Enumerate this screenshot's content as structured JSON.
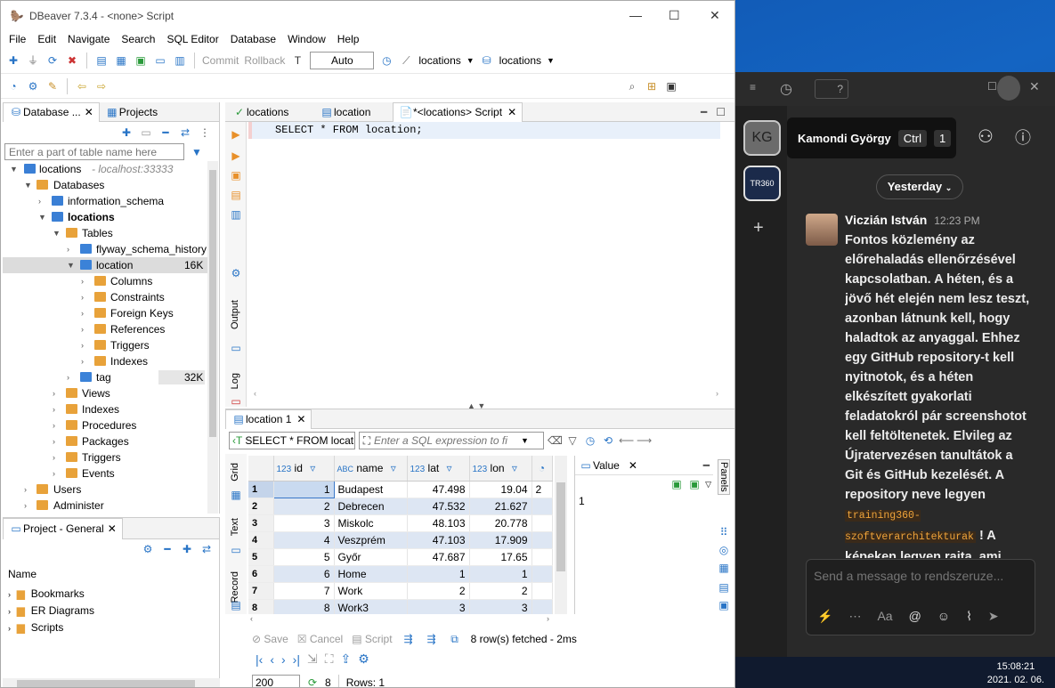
{
  "window": {
    "title": "DBeaver 7.3.4 - <none> Script"
  },
  "menu": [
    "File",
    "Edit",
    "Navigate",
    "Search",
    "SQL Editor",
    "Database",
    "Window",
    "Help"
  ],
  "toolbar": {
    "commit": "Commit",
    "rollback": "Rollback",
    "auto": "Auto",
    "conn1": "locations",
    "conn2": "locations"
  },
  "navigator": {
    "tab1": "Database ...",
    "tab2": "Projects",
    "filter_placeholder": "Enter a part of table name here",
    "conn": "locations",
    "conn_host": "- localhost:33333",
    "databases": "Databases",
    "info": "information_schema",
    "db": "locations",
    "tables": "Tables",
    "t1": "flyway_schema_history",
    "t2": "location",
    "t2size": "16K",
    "columns": "Columns",
    "constraints": "Constraints",
    "fkeys": "Foreign Keys",
    "refs": "References",
    "triggers": "Triggers",
    "indexes": "Indexes",
    "t3": "tag",
    "t3size": "32K",
    "views": "Views",
    "indexes2": "Indexes",
    "procedures": "Procedures",
    "packages": "Packages",
    "triggers2": "Triggers",
    "events": "Events",
    "users": "Users",
    "administer": "Administer"
  },
  "project": {
    "title": "Project - General",
    "name_col": "Name",
    "items": [
      "Bookmarks",
      "ER Diagrams",
      "Scripts"
    ]
  },
  "editor": {
    "tabs": [
      "locations",
      "location",
      "*<locations> Script"
    ],
    "sql": "SELECT * FROM location;",
    "side": [
      "Output",
      "Log"
    ]
  },
  "results": {
    "tab": "location 1",
    "query": "SELECT * FROM locati",
    "expr_placeholder": "Enter a SQL expression to fi",
    "columns": [
      "id",
      "name",
      "lat",
      "lon"
    ],
    "rows": [
      [
        "1",
        "1",
        "Budapest",
        "47.498",
        "19.04"
      ],
      [
        "2",
        "2",
        "Debrecen",
        "47.532",
        "21.627"
      ],
      [
        "3",
        "3",
        "Miskolc",
        "48.103",
        "20.778"
      ],
      [
        "4",
        "4",
        "Veszprém",
        "47.103",
        "17.909"
      ],
      [
        "5",
        "5",
        "Győr",
        "47.687",
        "17.65"
      ],
      [
        "6",
        "6",
        "Home",
        "1",
        "1"
      ],
      [
        "7",
        "7",
        "Work",
        "2",
        "2"
      ],
      [
        "8",
        "8",
        "Work3",
        "3",
        "3"
      ]
    ],
    "side": [
      "Grid",
      "Text",
      "Record"
    ],
    "value_title": "Value",
    "value": "1",
    "panels": "Panels",
    "save": "Save",
    "cancel": "Cancel",
    "script": "Script",
    "fetched": "8 row(s) fetched - 2ms",
    "limit": "200",
    "count": "8",
    "rows_label": "Rows: 1"
  },
  "teams": {
    "avatar": "KG",
    "tooltip_name": "Kamondi György",
    "tooltip_key": "Ctrl",
    "tooltip_num": "1",
    "logo": "TR360",
    "date_pill": "Yesterday",
    "author": "Viczián István",
    "time": "12:23 PM",
    "msg1": "Fontos közlemény az előrehaladás ellenőrzésével kapcsolatban.",
    "msg2": " A héten, és a jövő hét elején nem lesz teszt, azonban látnunk kell, hogy haladtok az anyaggal. Ehhez egy GitHub repository-t kell nyitnotok, és a héten elkészített gyakorlati feladatokról pár screenshotot kell feltöltenetek. Elvileg az Újratervezésen tanultátok a Git és GitHub kezelését. A repository neve legyen ",
    "code": "training360-szoftverarchitekturak",
    "msg3": " ! A képeken legyen rajta, ami alapján fel tudunk ismerni, pl.",
    "compose_placeholder": "Send a message to ​rendszeruze...",
    "time_clock": "15:08:21",
    "date_clock": "2021. 02. 06."
  }
}
